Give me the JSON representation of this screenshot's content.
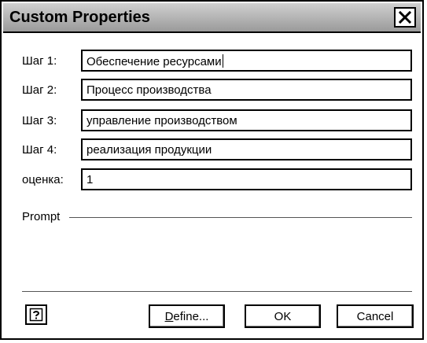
{
  "window": {
    "title": "Custom Properties",
    "close_icon": "close-icon"
  },
  "fields": [
    {
      "label": "Шаг 1:",
      "value": "Обеспечение ресурсами"
    },
    {
      "label": "Шаг 2:",
      "value": "Процесс производства"
    },
    {
      "label": "Шаг 3:",
      "value": "управление производством"
    },
    {
      "label": "Шаг 4:",
      "value": "реализация продукции"
    },
    {
      "label": "оценка:",
      "value": "1"
    }
  ],
  "prompt": {
    "label": "Prompt"
  },
  "buttons": {
    "help_icon": "help-icon",
    "define_label_first": "D",
    "define_label_rest": "efine...",
    "ok_label": "OK",
    "cancel_label": "Cancel"
  }
}
